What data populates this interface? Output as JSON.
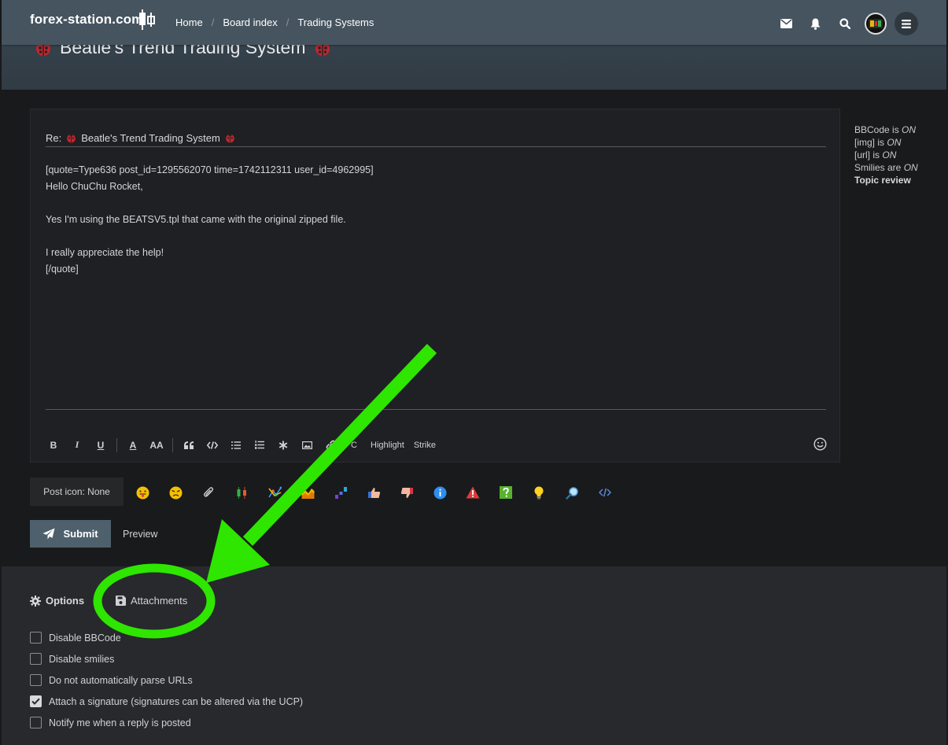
{
  "navbar": {
    "logo_text": "forex-station.com",
    "breadcrumb": [
      "Home",
      "Board index",
      "Trading Systems"
    ],
    "icons": [
      "envelope-icon",
      "bell-icon",
      "search-icon",
      "avatar",
      "hamburger-menu-icon"
    ]
  },
  "topic": {
    "title": "Beatle's Trend Trading System"
  },
  "editor": {
    "subject_prefix": "Re:",
    "subject_title": "Beatle's Trend Trading System",
    "message_lines": [
      "[quote=Type636 post_id=1295562070 time=1742112311 user_id=4962995]",
      "Hello ChuChu Rocket,",
      "",
      "Yes I'm using the BEATSV5.tpl that came with the original zipped file.",
      "",
      "I really appreciate the help!",
      "[/quote]"
    ],
    "toolbar": {
      "bold": "B",
      "italic": "I",
      "underline": "U",
      "font_color": "A",
      "font_size": "AA",
      "c_label": "C",
      "highlight": "Highlight",
      "strike": "Strike"
    }
  },
  "sidebar": {
    "bbcode_label": "BBCode is",
    "bbcode_state": "ON",
    "img_label": "[img] is",
    "img_state": "ON",
    "url_label": "[url] is",
    "url_state": "ON",
    "smilies_label": "Smilies are",
    "smilies_state": "ON",
    "topic_review": "Topic review"
  },
  "post_icons": {
    "label": "Post icon: None",
    "icons": [
      "tongue-face-icon",
      "angry-face-icon",
      "paperclip-icon",
      "candlestick-icon",
      "network-chart-icon",
      "area-chart-icon",
      "bar-steps-icon",
      "thumbs-up-icon",
      "thumbs-down-icon",
      "info-icon",
      "warning-icon",
      "question-icon",
      "lightbulb-icon",
      "magnifier-icon",
      "code-icon"
    ]
  },
  "actions": {
    "submit": "Submit",
    "preview": "Preview"
  },
  "options": {
    "tabs": {
      "options": "Options",
      "attachments": "Attachments"
    },
    "checkboxes": [
      {
        "label": "Disable BBCode",
        "checked": false
      },
      {
        "label": "Disable smilies",
        "checked": false
      },
      {
        "label": "Do not automatically parse URLs",
        "checked": false
      },
      {
        "label": "Attach a signature (signatures can be altered via the UCP)",
        "checked": true
      },
      {
        "label": "Notify me when a reply is posted",
        "checked": false
      }
    ]
  },
  "colors": {
    "navbar": "#45545f",
    "page_bg": "#191a1c",
    "panel_bg": "#1f2023",
    "submit_bg": "#4e606c",
    "annotation_green": "#2ee600"
  }
}
